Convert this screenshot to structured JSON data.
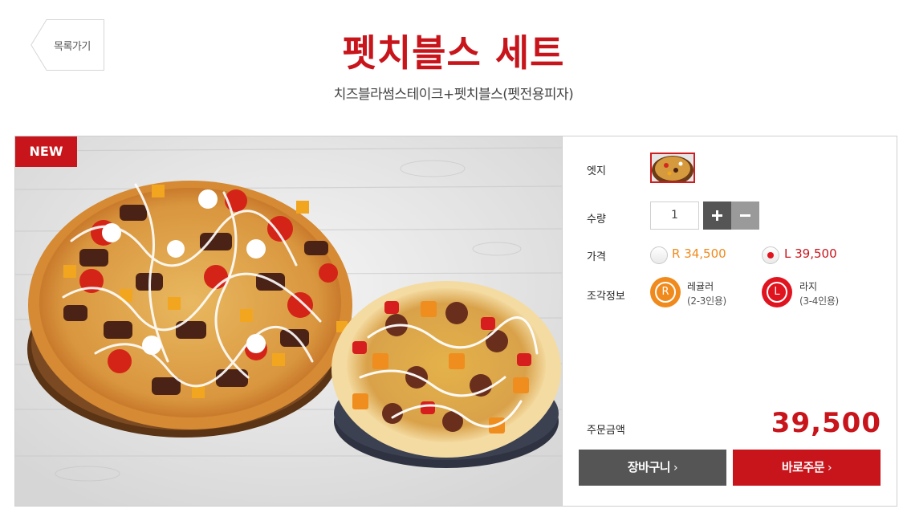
{
  "header": {
    "back_label": "목록가기",
    "title": "펫치블스 세트",
    "subtitle": "치즈블라썸스테이크+펫치블스(펫전용피자)"
  },
  "product": {
    "badge": "NEW",
    "image_icon": "pizza-photo"
  },
  "options": {
    "edge_label": "엣지",
    "quantity_label": "수량",
    "quantity_value": "1",
    "price_label": "가격",
    "price_regular": "R 34,500",
    "price_large": "L 39,500",
    "selected_size": "L",
    "slice_label": "조각정보",
    "sizes": [
      {
        "letter": "R",
        "name": "레귤러",
        "desc": "(2-3인용)",
        "color": "#f08a1c"
      },
      {
        "letter": "L",
        "name": "라지",
        "desc": "(3-4인용)",
        "color": "#e0141f"
      }
    ]
  },
  "order": {
    "total_label": "주문금액",
    "total_value": "39,500",
    "cart_label": "장바구니",
    "order_label": "바로주문",
    "chevron": "›"
  },
  "colors": {
    "brand_red": "#c8141b",
    "orange": "#f08a1c",
    "dark_button": "#555555"
  }
}
